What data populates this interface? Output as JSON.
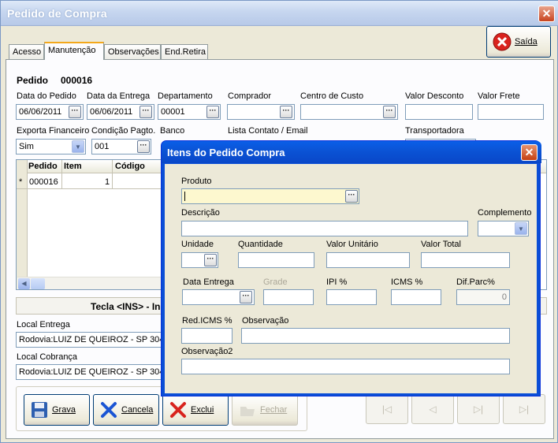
{
  "window": {
    "title": "Pedido de Compra",
    "close": "✕"
  },
  "tabs": [
    "Acesso",
    "Manutenção",
    "Observações",
    "End.Retira"
  ],
  "saida_label": "Saída",
  "pedido": {
    "label": "Pedido",
    "number": "000016"
  },
  "fields": {
    "data_pedido": {
      "label": "Data do Pedido",
      "value": "06/06/2011"
    },
    "data_entrega": {
      "label": "Data da Entrega",
      "value": "06/06/2011"
    },
    "departamento": {
      "label": "Departamento",
      "value": "00001"
    },
    "comprador": {
      "label": "Comprador",
      "value": ""
    },
    "centro_custo": {
      "label": "Centro de Custo",
      "value": ""
    },
    "valor_desconto": {
      "label": "Valor Desconto",
      "value": ""
    },
    "valor_frete": {
      "label": "Valor Frete",
      "value": ""
    },
    "exporta_financeiro": {
      "label": "Exporta Financeiro",
      "value": "Sim"
    },
    "condicao_pagto": {
      "label": "Condição Pagto.",
      "value": "001"
    },
    "banco": {
      "label": "Banco",
      "value": ""
    },
    "lista_contato": {
      "label": "Lista Contato / Email",
      "value": ""
    },
    "transportadora": {
      "label": "Transportadora",
      "value": ""
    }
  },
  "grid": {
    "columns": [
      "Pedido",
      "Item",
      "Código"
    ],
    "rows": [
      {
        "marker": "*",
        "pedido": "000016",
        "item": "1",
        "codigo": ""
      }
    ]
  },
  "tecla_banner": "Tecla <INS> - In",
  "local_entrega": {
    "label": "Local Entrega",
    "value": "Rodovia:LUIZ DE QUEIROZ - SP 304"
  },
  "local_cobranca": {
    "label": "Local Cobrança",
    "value": "Rodovia:LUIZ DE QUEIROZ - SP 304"
  },
  "buttons": {
    "grava": "Grava",
    "cancela": "Cancela",
    "exclui": "Exclui",
    "fechar": "Fechar"
  },
  "nav_buttons": [
    "|◁",
    "◁",
    "▷|",
    "▷|"
  ],
  "dialog": {
    "title": "Itens do Pedido Compra",
    "close": "✕",
    "produto": {
      "label": "Produto",
      "value": ""
    },
    "descricao": {
      "label": "Descrição",
      "value": ""
    },
    "complemento": {
      "label": "Complemento",
      "value": ""
    },
    "unidade": {
      "label": "Unidade",
      "value": ""
    },
    "quantidade": {
      "label": "Quantidade",
      "value": ""
    },
    "valor_unitario": {
      "label": "Valor Unitário",
      "value": ""
    },
    "valor_total": {
      "label": "Valor Total",
      "value": ""
    },
    "data_entrega": {
      "label": "Data Entrega",
      "value": ""
    },
    "grade": {
      "label": "Grade",
      "value": ""
    },
    "ipi": {
      "label": "IPI %",
      "value": ""
    },
    "icms": {
      "label": "ICMS %",
      "value": ""
    },
    "dif_parc": {
      "label": "Dif.Parc%",
      "value": "0"
    },
    "red_icms": {
      "label": "Red.ICMS %",
      "value": ""
    },
    "observacao": {
      "label": "Observação",
      "value": ""
    },
    "observacao2": {
      "label": "Observação2",
      "value": ""
    }
  },
  "colors": {
    "title_blue": "#0a4ed6",
    "focus_yellow": "#fdf8cf",
    "accent_orange": "#f3a81b"
  }
}
